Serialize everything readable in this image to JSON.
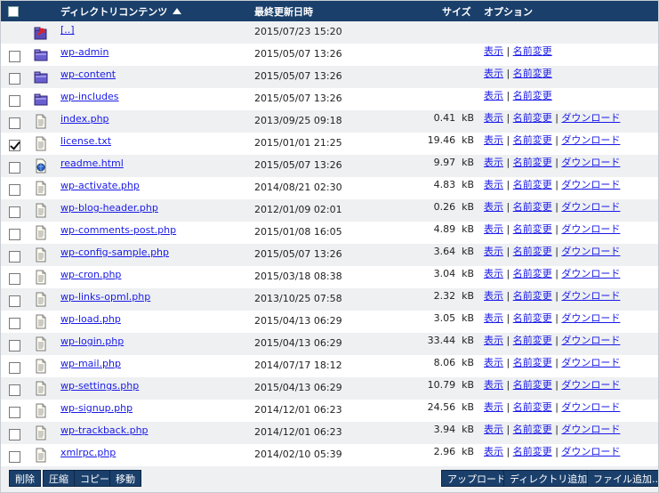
{
  "header": {
    "name_label": "ディレクトリコンテンツ",
    "date_label": "最終更新日時",
    "size_label": "サイズ",
    "options_label": "オプション"
  },
  "size_unit": "kB",
  "options": {
    "view": "表示",
    "rename": "名前変更",
    "download": "ダウンロード",
    "sep": " | "
  },
  "rows": [
    {
      "type": "up",
      "name": "[..]",
      "date": "2015/07/23 15:20",
      "size": "",
      "checked": false
    },
    {
      "type": "folder",
      "name": "wp-admin",
      "date": "2015/05/07 13:26",
      "size": "",
      "checked": false
    },
    {
      "type": "folder",
      "name": "wp-content",
      "date": "2015/05/07 13:26",
      "size": "",
      "checked": false
    },
    {
      "type": "folder",
      "name": "wp-includes",
      "date": "2015/05/07 13:26",
      "size": "",
      "checked": false
    },
    {
      "type": "file",
      "name": "index.php",
      "date": "2013/09/25 09:18",
      "size": "0.41",
      "checked": false
    },
    {
      "type": "file",
      "name": "license.txt",
      "date": "2015/01/01 21:25",
      "size": "19.46",
      "checked": true
    },
    {
      "type": "html",
      "name": "readme.html",
      "date": "2015/05/07 13:26",
      "size": "9.97",
      "checked": false
    },
    {
      "type": "file",
      "name": "wp-activate.php",
      "date": "2014/08/21 02:30",
      "size": "4.83",
      "checked": false
    },
    {
      "type": "file",
      "name": "wp-blog-header.php",
      "date": "2012/01/09 02:01",
      "size": "0.26",
      "checked": false
    },
    {
      "type": "file",
      "name": "wp-comments-post.php",
      "date": "2015/01/08 16:05",
      "size": "4.89",
      "checked": false
    },
    {
      "type": "file",
      "name": "wp-config-sample.php",
      "date": "2015/05/07 13:26",
      "size": "3.64",
      "checked": false
    },
    {
      "type": "file",
      "name": "wp-cron.php",
      "date": "2015/03/18 08:38",
      "size": "3.04",
      "checked": false
    },
    {
      "type": "file",
      "name": "wp-links-opml.php",
      "date": "2013/10/25 07:58",
      "size": "2.32",
      "checked": false
    },
    {
      "type": "file",
      "name": "wp-load.php",
      "date": "2015/04/13 06:29",
      "size": "3.05",
      "checked": false
    },
    {
      "type": "file",
      "name": "wp-login.php",
      "date": "2015/04/13 06:29",
      "size": "33.44",
      "checked": false
    },
    {
      "type": "file",
      "name": "wp-mail.php",
      "date": "2014/07/17 18:12",
      "size": "8.06",
      "checked": false
    },
    {
      "type": "file",
      "name": "wp-settings.php",
      "date": "2015/04/13 06:29",
      "size": "10.79",
      "checked": false
    },
    {
      "type": "file",
      "name": "wp-signup.php",
      "date": "2014/12/01 06:23",
      "size": "24.56",
      "checked": false
    },
    {
      "type": "file",
      "name": "wp-trackback.php",
      "date": "2014/12/01 06:23",
      "size": "3.94",
      "checked": false
    },
    {
      "type": "file",
      "name": "xmlrpc.php",
      "date": "2014/02/10 05:39",
      "size": "2.96",
      "checked": false
    }
  ],
  "footer": {
    "delete": "削除",
    "compress": "圧縮",
    "copy": "コピー",
    "move": "移動",
    "upload": "アップロード...",
    "add_dir": "ディレクトリ追加...",
    "add_file": "ファイル追加..."
  }
}
